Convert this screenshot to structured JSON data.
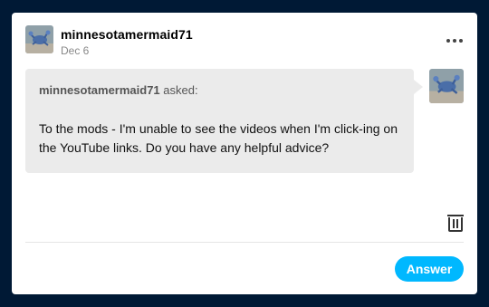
{
  "post": {
    "username": "minnesotamermaid71",
    "date": "Dec 6",
    "avatar_icon": "blue-crab-avatar",
    "more_icon": "more-options-icon"
  },
  "ask": {
    "asker_name": "minnesotamermaid71",
    "asked_suffix": " asked:",
    "question": "To the mods - I'm unable to see the videos when I'm click-ing on the YouTube links. Do you have any helpful advice?",
    "asker_avatar_icon": "blue-crab-avatar"
  },
  "footer": {
    "delete_icon": "trash-icon",
    "answer_label": "Answer"
  },
  "colors": {
    "page_background": "#001935",
    "card_background": "#ffffff",
    "bubble_background": "#ebebeb",
    "answer_button": "#00b8ff"
  }
}
